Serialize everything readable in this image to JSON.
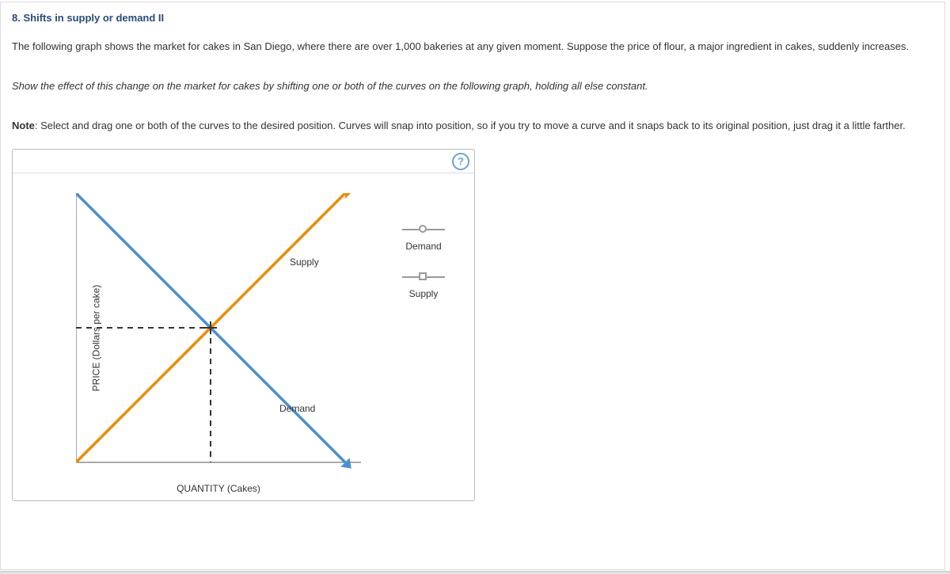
{
  "header": {
    "number": "8.",
    "title": "Shifts in supply or demand II"
  },
  "paragraph1": "The following graph shows the market for cakes in San Diego, where there are over 1,000 bakeries at any given moment. Suppose the price of flour, a major ingredient in cakes, suddenly increases.",
  "instruction": "Show the effect of this change on the market for cakes by shifting one or both of the curves on the following graph, holding all else constant.",
  "note_label": "Note",
  "note_text": ": Select and drag one or both of the curves to the desired position. Curves will snap into position, so if you try to move a curve and it snaps back to its original position, just drag it a little farther.",
  "help_icon": "?",
  "axes": {
    "y": "PRICE (Dollars per cake)",
    "x": "QUANTITY (Cakes)"
  },
  "curve_labels": {
    "supply": "Supply",
    "demand": "Demand"
  },
  "legend": {
    "demand": "Demand",
    "supply": "Supply"
  },
  "chart_data": {
    "type": "line",
    "title": "",
    "xlabel": "QUANTITY (Cakes)",
    "ylabel": "PRICE (Dollars per cake)",
    "xlim": [
      0,
      100
    ],
    "ylim": [
      0,
      100
    ],
    "series": [
      {
        "name": "Demand",
        "color": "#4a8fd1",
        "x": [
          0,
          100
        ],
        "y": [
          100,
          0
        ]
      },
      {
        "name": "Supply",
        "color": "#f08a00",
        "x": [
          0,
          100
        ],
        "y": [
          0,
          100
        ]
      }
    ],
    "equilibrium": {
      "x": 50,
      "y": 50
    },
    "colors": {
      "demand": "#4a8fd1",
      "supply": "#f08a00",
      "axes": "#555"
    }
  }
}
